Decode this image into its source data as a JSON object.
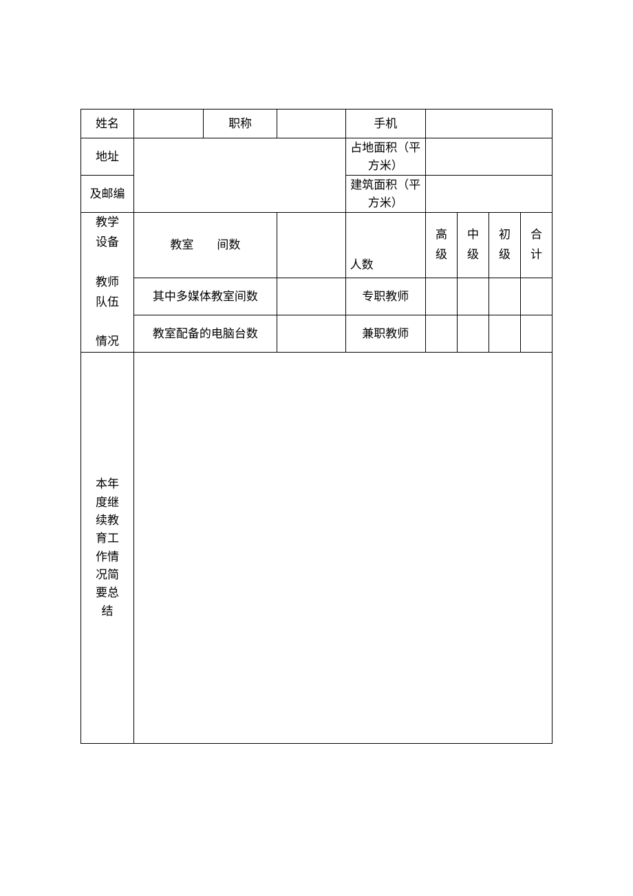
{
  "rows": {
    "r1": {
      "name_label": "姓名",
      "name_value": "",
      "title_label": "职称",
      "title_value": "",
      "phone_label": "手机",
      "phone_value": ""
    },
    "r2": {
      "address_label": "地址",
      "land_area_label": "占地面积（平方米）",
      "land_area_value": ""
    },
    "r3": {
      "zip_label": "及邮编",
      "building_area_label": "建筑面积（平方米）",
      "building_area_value": ""
    },
    "r4": {
      "side_label": "教学设备\n\n教师队伍\n\n情况",
      "classroom_label": "教室　　间数",
      "classroom_value": "",
      "people_count_label": "人数",
      "col_senior": "高级",
      "col_mid": "中级",
      "col_junior": "初级",
      "col_total": "合计"
    },
    "r5": {
      "multimedia_label": "其中多媒体教室间数",
      "multimedia_value": "",
      "fulltime_label": "专职教师",
      "ft_senior": "",
      "ft_mid": "",
      "ft_junior": "",
      "ft_total": ""
    },
    "r6": {
      "computers_label": "教室配备的电脑台数",
      "computers_value": "",
      "parttime_label": "兼职教师",
      "pt_senior": "",
      "pt_mid": "",
      "pt_junior": "",
      "pt_total": ""
    },
    "r7": {
      "summary_label": "本年度继续教育工作情况简要总结",
      "summary_value": ""
    }
  }
}
